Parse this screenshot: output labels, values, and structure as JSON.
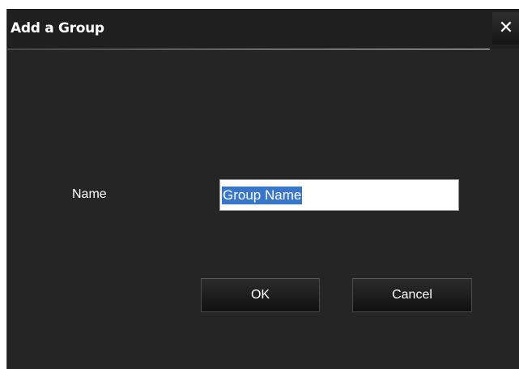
{
  "dialog": {
    "title": "Add a Group",
    "close_label": "✕"
  },
  "form": {
    "name_label": "Name",
    "name_value": "Group Name",
    "name_selected": true
  },
  "buttons": {
    "ok_label": "OK",
    "cancel_label": "Cancel"
  },
  "colors": {
    "dialog_background": "#252525",
    "selection_highlight": "#3876c9",
    "text": "#ffffff"
  }
}
